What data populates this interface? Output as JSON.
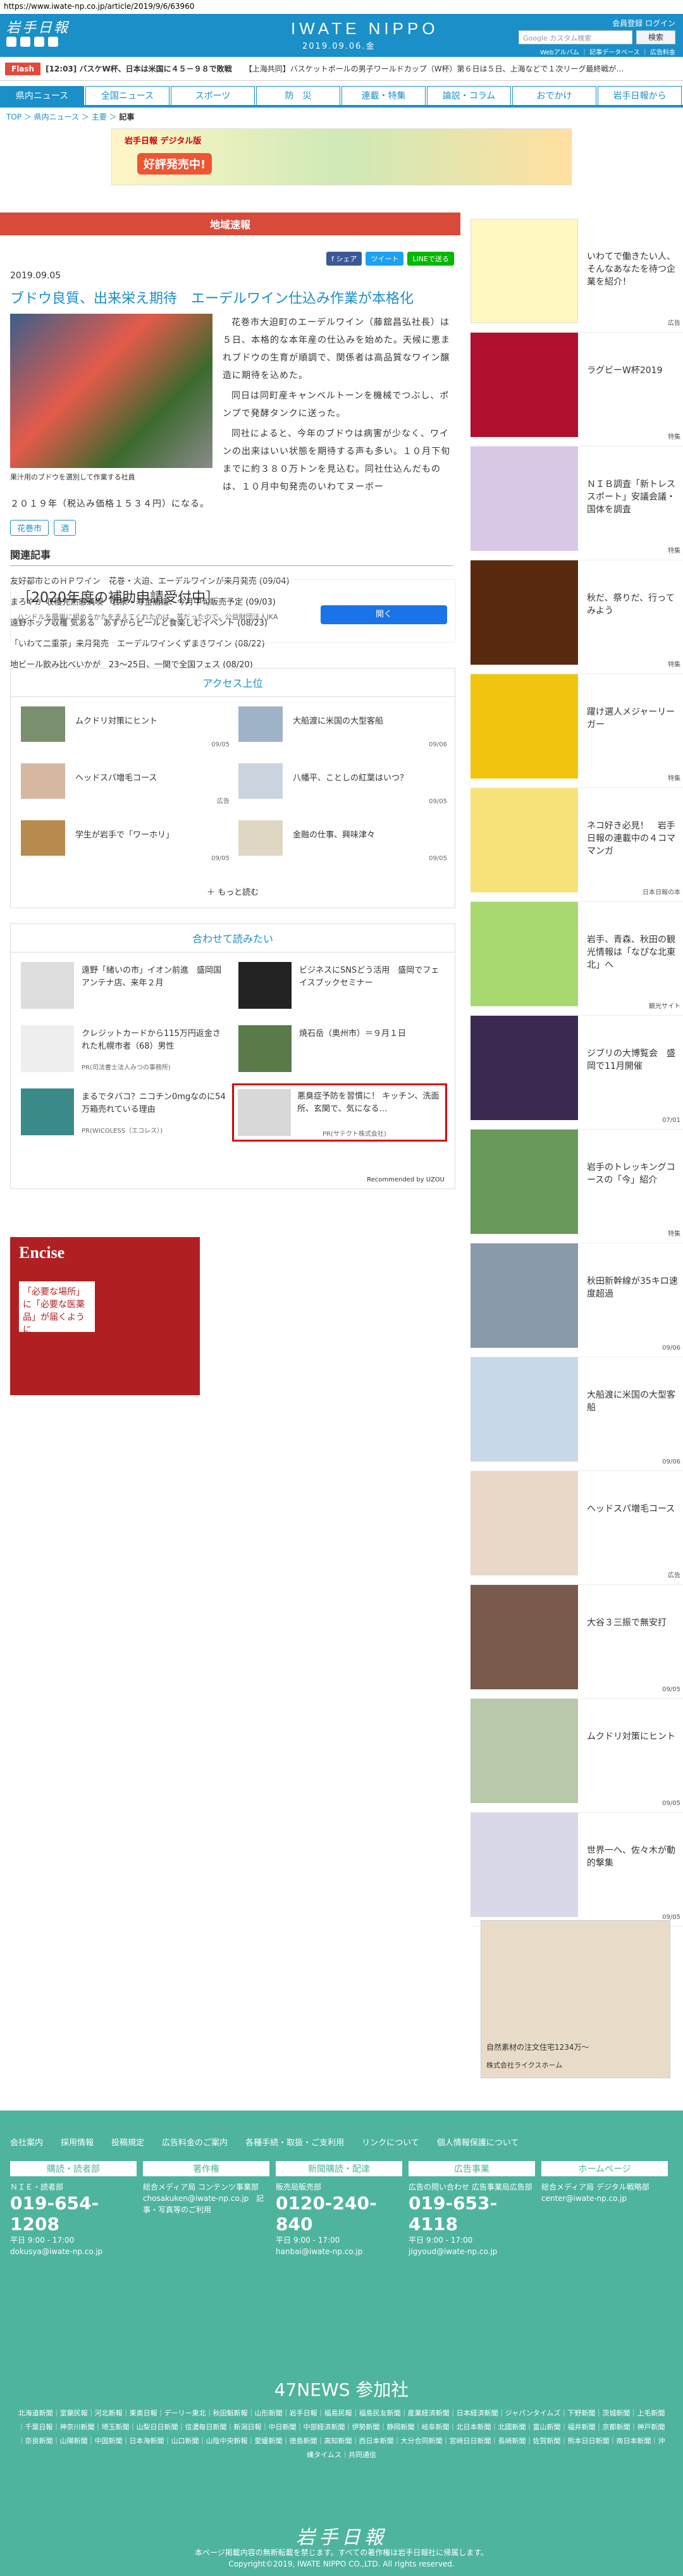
{
  "url": "https://www.iwate-np.co.jp/article/2019/9/6/63960",
  "header": {
    "logo": "岩手日報",
    "brand": "IWATE NIPPO",
    "date": "2019.09.06.金",
    "links": "会員登録 ログイン",
    "search_placeholder": "Google カスタム検索",
    "search_btn": "検索",
    "sublinks": "Webアルバム ｜ 記事データベース ｜ 広告料金"
  },
  "ticker": {
    "tag": "Flash",
    "item1": "[12:03] バスケW杯、日本は米国に４５－９８で敗戦",
    "item2": "【上海共同】バスケットボールの男子ワールドカップ（W杯）第６日は５日、上海などで１次リーグ最終戦が…"
  },
  "nav": [
    "県内ニュース",
    "全国ニュース",
    "スポーツ",
    "防　災",
    "連載・特集",
    "論説・コラム",
    "おでかけ",
    "岩手日報から"
  ],
  "breadcrumb": {
    "top": "TOP",
    "sep1": " ＞ ",
    "p1": "県内ニュース",
    "sep2": " ＞ ",
    "p2": "主要",
    "sep3": " ＞ ",
    "cur": "記事"
  },
  "banner": {
    "t1": "岩手日報 デジタル版",
    "t2": "好評発売中!"
  },
  "article": {
    "section": "地域速報",
    "date": "2019.09.05",
    "share": [
      "f シェア",
      "ツイート",
      "LINEで送る"
    ],
    "title": "ブドウ良質、出来栄え期待　エーデルワイン仕込み作業が本格化",
    "caption": "果汁用のブドウを選別して作業する社員",
    "p1": "花巻市大迫町のエーデルワイン（藤舘昌弘社長）は５日、本格的な本年産の仕込みを始めた。天候に恵まれブドウの生育が順調で、関係者は高品質なワイン醸造に期待を込めた。",
    "p2": "同日は同町産キャンベルトーンを機械でつぶし、ポンプで発酵タンクに送った。",
    "p3": "同社によると、今年のブドウは病害が少なく、ワインの出来はいい状態を期待する声も多い。１０月下旬までに約３８０万トンを見込む。同社仕込んだものは、１０月中旬発売のいわてヌーボー",
    "p4": "２０１９年（税込み価格１５３４円）になる。",
    "tags": [
      "花巻市",
      "酒"
    ]
  },
  "related": {
    "title": "関連記事",
    "items": [
      "友好都市とのＨＰワイン　花巻・大迫、エーデルワインが来月発売 (09/04)",
      "まろやか 収穫完熟感満喫　岩泉・寿金酒造、今月中旬販売予定 (09/03)",
      "遠野ホップ収穫 気ある　あすからビールと食楽しむイベント (08/23)",
      "「いわて二重茶」来月発売　エーデルワインくずまきワイン (08/22)",
      "地ビール飲み比べいかが　23～25日、一関で全国フェス (08/20)"
    ]
  },
  "ad2": {
    "title": "［2020年度の補助申請受付中］",
    "sub": "ハンドルを簡単に組めるかたを支えてくれたのは、苦だったので。公益財団法人JKA",
    "btn": "開く"
  },
  "ranking": {
    "title": "アクセス上位",
    "items": [
      {
        "t": "ムクドリ対策にヒント",
        "d": "09/05"
      },
      {
        "t": "大船渡に米国の大型客船",
        "d": "09/06"
      },
      {
        "t": "ヘッドスパ増毛コース",
        "d": "広告"
      },
      {
        "t": "八幡平、ことしの紅葉はいつ？",
        "d": "09/05"
      },
      {
        "t": "学生が岩手で「ワーホリ」",
        "d": "09/05"
      },
      {
        "t": "金融の仕事、興味津々",
        "d": "09/05"
      }
    ],
    "more": "もっと読む"
  },
  "recommend": {
    "title": "合わせて読みたい",
    "items": [
      {
        "t": "遠野「緒いの市」イオン前進　盛岡国アンテナ店、来年２月",
        "p": ""
      },
      {
        "t": "ビジネスにSNSどう活用　盛岡でフェイスブックセミナー",
        "p": ""
      },
      {
        "t": "クレジットカードから115万円返金された札幌市者（68）男性",
        "p": "PR(司法書士法人みつの事務所)"
      },
      {
        "t": "焼石岳（奥州市）＝９月１日",
        "p": ""
      },
      {
        "t": "まるでタバコ？ニコチン0mgなのに54万箱売れている理由",
        "p": "PR(WICOLESS（エコレス）)"
      },
      {
        "t": "悪臭症予防を習慣に！ キッチン、洗面所、玄関で、気になる…",
        "p": "PR(サテクト株式会社)"
      }
    ],
    "powered": "Recommended by UZOU"
  },
  "adfoot": {
    "e": "Encise",
    "w": "「必要な場所」に「必要な医薬品」が届くように"
  },
  "sidebar": [
    {
      "t": "いわてで働きたい人、そんなあなたを待つ企業を紹介！",
      "l": "広告"
    },
    {
      "t": "ラグビーW杯2019",
      "l": "特集"
    },
    {
      "t": "ＮＩＢ調査「新トレス スポート」安議会議・国体を調査",
      "l": "特集"
    },
    {
      "t": "秋だ、祭りだ、行ってみよう",
      "l": "特集"
    },
    {
      "t": "躍け選人メジャーリーガー",
      "l": "特集"
    },
    {
      "t": "ネコ好き必見！　岩手日報の連載中の４コママンガ",
      "l": "日本日報の本"
    },
    {
      "t": "岩手、青森、秋田の観光情報は「なぴな北東北」へ",
      "l": "観光サイト"
    },
    {
      "t": "ジブリの大博覧会　盛岡で11月開催",
      "l": "07/01"
    },
    {
      "t": "岩手のトレッキングコースの「今」紹介",
      "l": "特集"
    },
    {
      "t": "秋田新幹線が35キロ速度超過",
      "l": "09/06"
    },
    {
      "t": "大船渡に米国の大型客船",
      "l": "09/06"
    },
    {
      "t": "ヘッドスパ増毛コース",
      "l": "広告"
    },
    {
      "t": "大谷３三振で無安打",
      "l": "09/05"
    },
    {
      "t": "ムクドリ対策にヒント",
      "l": "09/05"
    },
    {
      "t": "世界一へ、佐々木が動的撃集",
      "l": "09/05"
    },
    {
      "t": "自然素材の注文住宅1234万〜",
      "l": "株式会社ライクスホーム"
    }
  ],
  "footer": {
    "links": [
      "会社案内",
      "採用情報",
      "投稿規定",
      "広告料金のご案内",
      "各種手続・取扱・ご支利用",
      "リンクについて",
      "個人情報保護について"
    ],
    "cols": [
      {
        "h": "購読・読者部",
        "s": "ＮＩＥ・読者部",
        "ph": "019-654-1208",
        "sm": "平日 9:00 - 17:00　dokusya@iwate-np.co.jp"
      },
      {
        "h": "著作権",
        "s": "総合メディア局 コンテンツ事業部",
        "ph": "",
        "sm": "chosakuken@iwate-np.co.jp　記事・写真等のご利用"
      },
      {
        "h": "新聞購読・配達",
        "s": "販売局販売部",
        "ph": "0120-240-840",
        "sm": "平日 9:00 - 17:00　hanbai@iwate-np.co.jp"
      },
      {
        "h": "広告事業",
        "s": "広告の問い合わせ 広告事業局広告部",
        "ph": "019-653-4118",
        "sm": "平日 9:00 - 17:00　jigyoud@iwate-np.co.jp"
      },
      {
        "h": "ホームページ",
        "s": "総合メディア局 デジタル戦略部",
        "ph": "",
        "sm": "center@iwate-np.co.jp"
      }
    ],
    "n47": "47NEWS 参加社",
    "n47list": "北海道新聞｜室蘭民報｜河北新報｜東奥日報｜デーリー東北｜秋田魁新報｜山形新聞｜岩手日報｜福島民報｜福島民友新聞｜産業経済新聞｜日本経済新聞｜ジャパンタイムズ｜下野新聞｜茨城新聞｜上毛新聞｜千葉日報｜神奈川新聞｜埼玉新聞｜山梨日日新聞｜信濃毎日新聞｜新潟日報｜中日新聞｜中部経済新聞｜伊勢新聞｜静岡新聞｜岐阜新聞｜北日本新聞｜北國新聞｜富山新聞｜福井新聞｜京都新聞｜神戸新聞｜奈良新聞｜山陽新聞｜中国新聞｜日本海新聞｜山口新聞｜山陰中央新報｜愛媛新聞｜徳島新聞｜高知新聞｜西日本新聞｜大分合同新聞｜宮崎日日新聞｜長崎新聞｜佐賀新聞｜熊本日日新聞｜南日本新聞｜沖縄タイムス｜共同通信",
    "logo": "岩手日報",
    "copy1": "本ページ掲載内容の無断転載を禁じます。すべての著作権は岩手日報社に帰属します。",
    "copy2": "Copyright©2019, IWATE NIPPO CO.,LTD. All rights reserved."
  }
}
